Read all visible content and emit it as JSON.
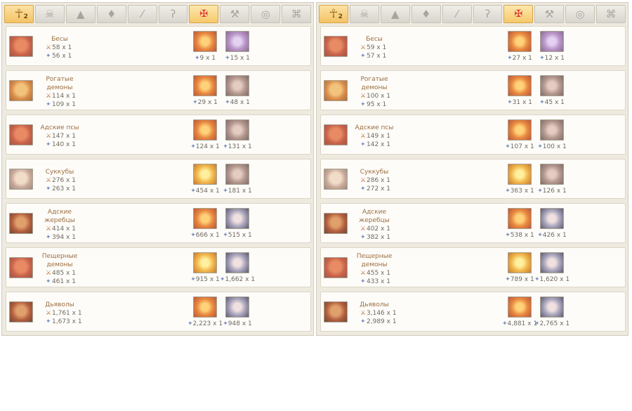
{
  "tabs": [
    {
      "name": "tab-ankh",
      "icon": "ankh-icon",
      "glyph": "☥",
      "count": "2",
      "state": "active"
    },
    {
      "name": "tab-skull",
      "icon": "skull-icon",
      "glyph": "☠",
      "count": "",
      "state": ""
    },
    {
      "name": "tab-horn",
      "icon": "horn-icon",
      "glyph": "▲",
      "count": "",
      "state": ""
    },
    {
      "name": "tab-leaf",
      "icon": "leaf-icon",
      "glyph": "♦",
      "count": "",
      "state": ""
    },
    {
      "name": "tab-sword",
      "icon": "sword-icon",
      "glyph": "⁄",
      "count": "",
      "state": ""
    },
    {
      "name": "tab-scythe",
      "icon": "scythe-icon",
      "glyph": "ʔ",
      "count": "",
      "state": ""
    },
    {
      "name": "tab-demon",
      "icon": "demon-sigil-icon",
      "glyph": "✠",
      "count": "",
      "state": "sel"
    },
    {
      "name": "tab-hammer",
      "icon": "hammer-icon",
      "glyph": "⚒",
      "count": "",
      "state": ""
    },
    {
      "name": "tab-helmet",
      "icon": "helmet-icon",
      "glyph": "◎",
      "count": "",
      "state": ""
    },
    {
      "name": "tab-dragon",
      "icon": "dragon-icon",
      "glyph": "⌘",
      "count": "",
      "state": ""
    }
  ],
  "panels": [
    {
      "rows": [
        {
          "name": "Бесы",
          "att": "58 x 1",
          "hp": "56 x 1",
          "a": "9 x 1",
          "b": "15 x 1",
          "icon": "",
          "ca": "fire",
          "cb": "violet"
        },
        {
          "name": "Рогатые демоны",
          "att": "114 x 1",
          "hp": "109 x 1",
          "a": "29 x 1",
          "b": "48 x 1",
          "icon": "gold",
          "ca": "fire",
          "cb": "grey"
        },
        {
          "name": "Адские псы",
          "att": "147 x 1",
          "hp": "140 x 1",
          "a": "124 x 1",
          "b": "131 x 1",
          "icon": "",
          "ca": "fire",
          "cb": "grey"
        },
        {
          "name": "Суккубы",
          "att": "276 x 1",
          "hp": "263 x 1",
          "a": "454 x 1",
          "b": "181 x 1",
          "icon": "pale",
          "ca": "gold",
          "cb": "grey"
        },
        {
          "name": "Адские жеребцы",
          "att": "414 x 1",
          "hp": "394 x 1",
          "a": "666 x 1",
          "b": "515 x 1",
          "icon": "dark",
          "ca": "fire",
          "cb": "steel"
        },
        {
          "name": "Пещерные демоны",
          "att": "485 x 1",
          "hp": "461 x 1",
          "a": "915 x 1",
          "b": "1,662 x 1",
          "icon": "",
          "ca": "gold",
          "cb": "steel"
        },
        {
          "name": "Дьяволы",
          "att": "1,761 x 1",
          "hp": "1,673 x 1",
          "a": "2,223 x 1",
          "b": "948 x 1",
          "icon": "dark",
          "ca": "fire",
          "cb": "steel"
        }
      ]
    },
    {
      "rows": [
        {
          "name": "Бесы",
          "att": "59 x 1",
          "hp": "57 x 1",
          "a": "27 x 1",
          "b": "12 x 1",
          "icon": "",
          "ca": "fire",
          "cb": "violet"
        },
        {
          "name": "Рогатые демоны",
          "att": "100 x 1",
          "hp": "95 x 1",
          "a": "31 x 1",
          "b": "45 x 1",
          "icon": "gold",
          "ca": "fire",
          "cb": "grey"
        },
        {
          "name": "Адские псы",
          "att": "149 x 1",
          "hp": "142 x 1",
          "a": "107 x 1",
          "b": "100 x 1",
          "icon": "",
          "ca": "fire",
          "cb": "grey"
        },
        {
          "name": "Суккубы",
          "att": "286 x 1",
          "hp": "272 x 1",
          "a": "363 x 1",
          "b": "126 x 1",
          "icon": "pale",
          "ca": "gold",
          "cb": "grey"
        },
        {
          "name": "Адские жеребцы",
          "att": "402 x 1",
          "hp": "382 x 1",
          "a": "538 x 1",
          "b": "426 x 1",
          "icon": "dark",
          "ca": "fire",
          "cb": "steel"
        },
        {
          "name": "Пещерные демоны",
          "att": "455 x 1",
          "hp": "433 x 1",
          "a": "789 x 1",
          "b": "1,620 x 1",
          "icon": "",
          "ca": "gold",
          "cb": "steel"
        },
        {
          "name": "Дьяволы",
          "att": "3,146 x 1",
          "hp": "2,989 x 1",
          "a": "4,881 x 1",
          "b": "2,765 x 1",
          "icon": "dark",
          "ca": "fire",
          "cb": "steel"
        }
      ]
    }
  ]
}
